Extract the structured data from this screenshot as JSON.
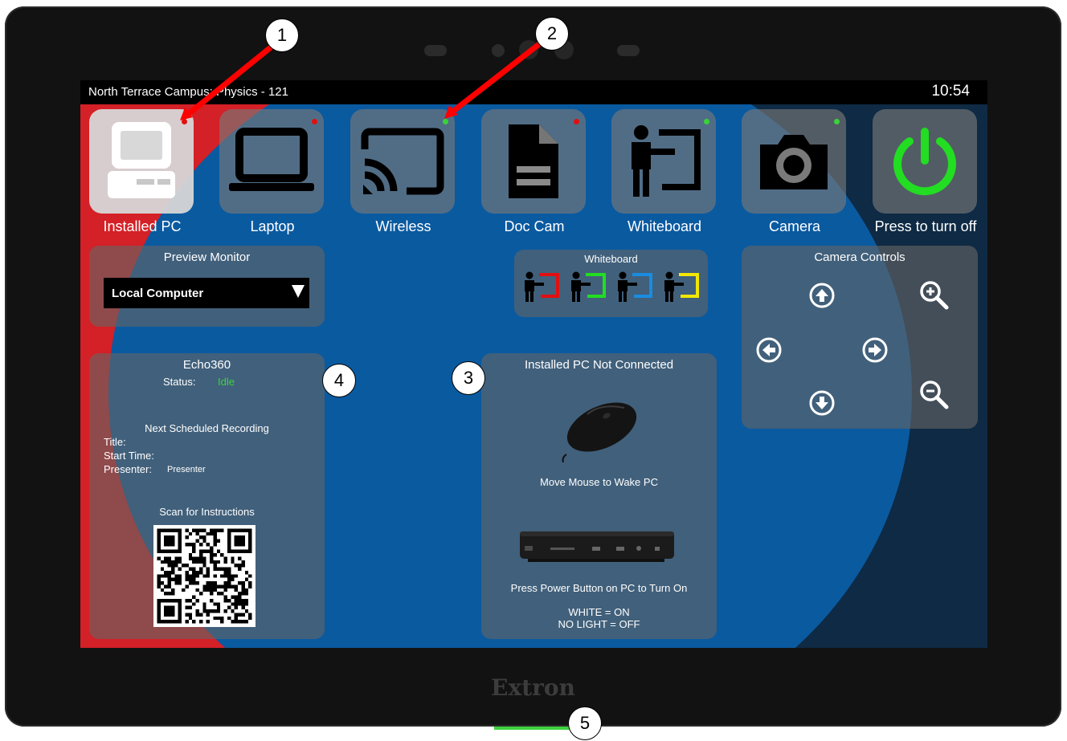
{
  "topbar": {
    "location": "North Terrace Campus: Physics - 121",
    "time": "10:54"
  },
  "sources": [
    {
      "label": "Installed PC",
      "icon": "desktop-pc-icon",
      "indicator": "#e01010",
      "active": true
    },
    {
      "label": "Laptop",
      "icon": "laptop-icon",
      "indicator": "#e01010",
      "active": false
    },
    {
      "label": "Wireless",
      "icon": "cast-icon",
      "indicator": "#39d339",
      "active": false
    },
    {
      "label": "Doc Cam",
      "icon": "document-icon",
      "indicator": "#e01010",
      "active": false
    },
    {
      "label": "Whiteboard",
      "icon": "presenter-board-icon",
      "indicator": "#39d339",
      "active": false
    },
    {
      "label": "Camera",
      "icon": "camera-icon",
      "indicator": "#39d339",
      "active": false
    },
    {
      "label": "Press to turn off",
      "icon": "power-icon",
      "indicator": null,
      "active": false
    }
  ],
  "preview": {
    "title": "Preview Monitor",
    "selected": "Local Computer"
  },
  "whiteboard": {
    "title": "Whiteboard",
    "colors": [
      "#e01010",
      "#22dd22",
      "#1a8ce0",
      "#f3e600"
    ]
  },
  "camera_controls": {
    "title": "Camera Controls"
  },
  "echo": {
    "title": "Echo360",
    "status_label": "Status:",
    "status_value": "Idle",
    "status_color": "#3bd43b",
    "next_heading": "Next Scheduled Recording",
    "title_label": "Title:",
    "start_label": "Start Time:",
    "presenter_label": "Presenter:",
    "presenter_value": "Presenter",
    "scan_label": "Scan for Instructions"
  },
  "pc_panel": {
    "title": "Installed PC Not Connected",
    "wake_text": "Move Mouse to Wake PC",
    "power_text": "Press Power Button on PC to Turn On",
    "white_on": "WHITE = ON",
    "no_light_off": "NO LIGHT = OFF"
  },
  "brand": "Extron",
  "callouts": [
    "1",
    "2",
    "3",
    "4",
    "5"
  ],
  "accent": {
    "red": "#d42027",
    "blue": "#0a5aa0",
    "green": "#22dd22"
  }
}
